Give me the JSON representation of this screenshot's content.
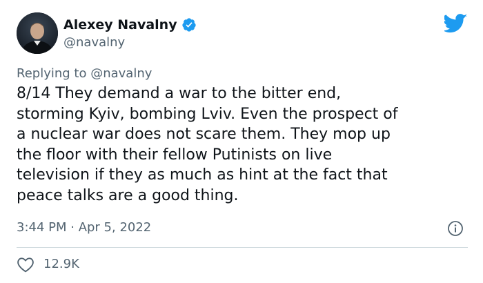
{
  "author": {
    "display_name": "Alexey Navalny",
    "handle": "@navalny"
  },
  "reply": {
    "prefix": "Replying to ",
    "mention": "@navalny"
  },
  "tweet": {
    "text": "8/14 They demand a war to the bitter end,\nstorming Kyiv, bombing Lviv. Even the prospect of\na nuclear war does not scare them. They mop up\nthe floor with their fellow Putinists on live\ntelevision if they as much as hint at the fact that\npeace talks are a good thing."
  },
  "meta": {
    "timestamp": "3:44 PM · Apr 5, 2022"
  },
  "engagement": {
    "likes": "12.9K"
  },
  "icons": {
    "verified": "verified-badge-icon",
    "brand": "twitter-bird-icon",
    "info": "info-icon",
    "like": "heart-icon"
  },
  "colors": {
    "brand_blue": "#1d9bf0",
    "text_primary": "#0f1419",
    "text_secondary": "#536471",
    "divider": "#cfd9de"
  }
}
